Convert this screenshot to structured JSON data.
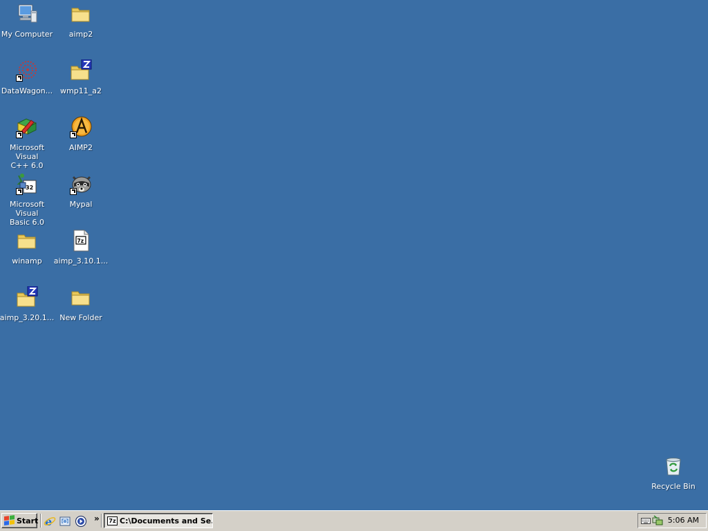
{
  "desktop": {
    "background_color": "#3a6ea5",
    "icons": [
      {
        "label": "My Computer",
        "icon": "my-computer-icon"
      },
      {
        "label": "aimp2",
        "icon": "folder-icon"
      },
      {
        "label": "DataWagon...",
        "icon": "datawagon-icon",
        "shortcut": true
      },
      {
        "label": "wmp11_a2",
        "icon": "zip-folder-icon"
      },
      {
        "label": "Microsoft Visual\nC++ 6.0",
        "icon": "visual-cpp-icon",
        "shortcut": true
      },
      {
        "label": "AIMP2",
        "icon": "aimp-icon",
        "shortcut": true
      },
      {
        "label": "Microsoft Visual\nBasic 6.0",
        "icon": "visual-basic-icon",
        "shortcut": true
      },
      {
        "label": "Mypal",
        "icon": "mypal-raccoon-icon",
        "shortcut": true
      },
      {
        "label": "winamp",
        "icon": "folder-icon"
      },
      {
        "label": "aimp_3.10.1...",
        "icon": "7zip-archive-icon"
      },
      {
        "label": "aimp_3.20.1...",
        "icon": "zip-folder-icon"
      },
      {
        "label": "New Folder",
        "icon": "folder-icon"
      },
      {
        "label": "Recycle Bin",
        "icon": "recycle-bin-icon"
      }
    ]
  },
  "taskbar": {
    "start_label": "Start",
    "quick_launch": [
      {
        "icon": "internet-explorer-icon"
      },
      {
        "icon": "show-desktop-icon"
      },
      {
        "icon": "media-player-icon"
      }
    ],
    "chevron": "»",
    "tasks": [
      {
        "label": "C:\\Documents and Se...",
        "icon": "7zip-icon",
        "active": true
      }
    ],
    "tray": {
      "icons": [
        "keyboard-icon",
        "network-icon"
      ],
      "clock": "5:06 AM"
    }
  }
}
